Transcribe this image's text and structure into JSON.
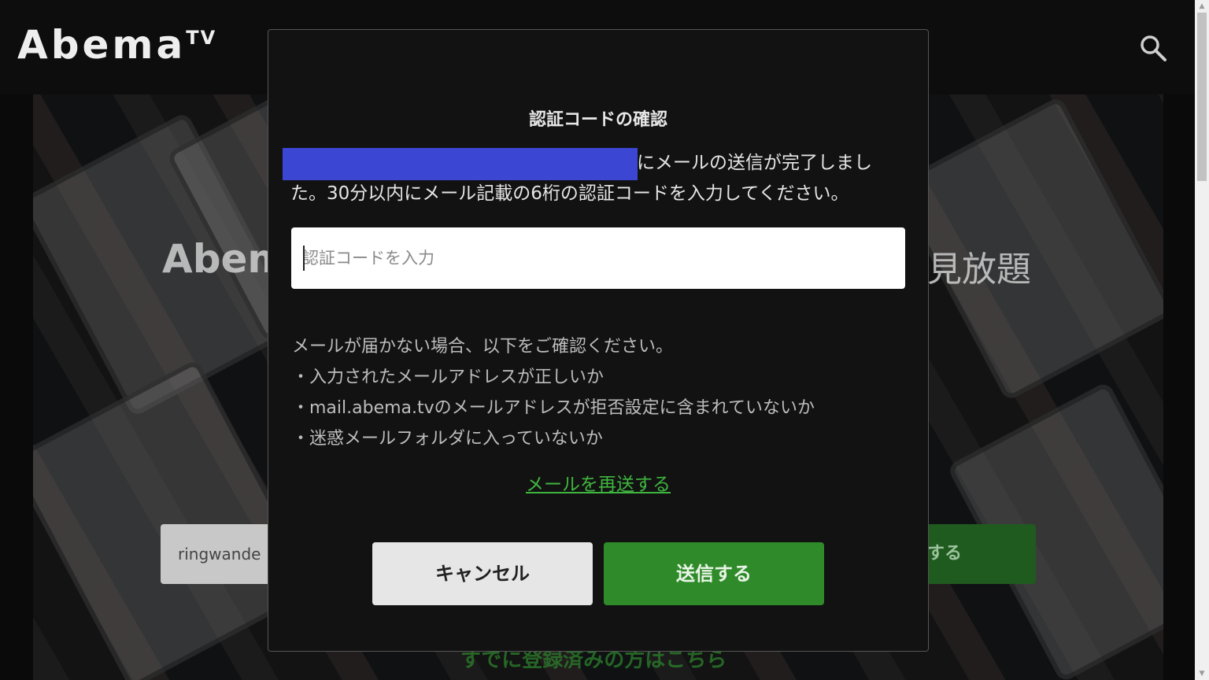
{
  "header": {
    "logo_text": "Abema",
    "logo_sup": "TV",
    "search_icon": "search-icon"
  },
  "background": {
    "hero_title_left": "Abem",
    "hero_title_right": "見放題",
    "email_input_value": "ringwande",
    "submit_label": "する",
    "login_link": "すでに登録済みの方はこちら"
  },
  "modal": {
    "title": "認証コードの確認",
    "message": "にメールの送信が完了しました。30分以内にメール記載の6桁の認証コードを入力してください。",
    "code_placeholder": "認証コードを入力",
    "help_heading": "メールが届かない場合、以下をご確認ください。",
    "help_items": [
      "・入力されたメールアドレスが正しいか",
      "・mail.abema.tvのメールアドレスが拒否設定に含まれていないか",
      "・迷惑メールフォルダに入っていないか"
    ],
    "resend_link": "メールを再送する",
    "cancel_label": "キャンセル",
    "send_label": "送信する"
  },
  "colors": {
    "accent_green": "#2f8a2a",
    "link_green": "#3fb53f",
    "redaction_blue": "#3b46d3",
    "modal_bg": "#121212"
  },
  "scrollbar": {
    "up_arrow": "▲",
    "down_arrow": "▼"
  }
}
